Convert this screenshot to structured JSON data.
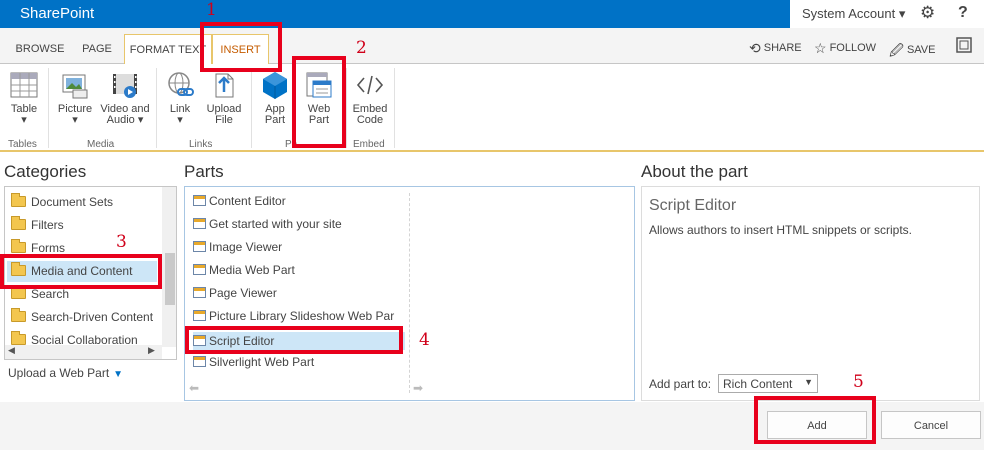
{
  "suite": {
    "brand": "SharePoint",
    "account": "System Account",
    "account_caret": "▾",
    "settings_icon": "gear-icon",
    "help_icon": "?"
  },
  "tabs": [
    "BROWSE",
    "PAGE",
    "FORMAT TEXT",
    "INSERT"
  ],
  "selected_tab": "INSERT",
  "ribbon_tools": {
    "share": "SHARE",
    "follow": "FOLLOW",
    "save": "SAVE"
  },
  "ribbon": {
    "buttons": {
      "table": "Table",
      "picture": "Picture",
      "video_audio_1": "Video and",
      "video_audio_2": "Audio",
      "link": "Link",
      "upload_1": "Upload",
      "upload_2": "File",
      "app_part_1": "App",
      "app_part_2": "Part",
      "web_part_1": "Web",
      "web_part_2": "Part",
      "embed_1": "Embed",
      "embed_2": "Code",
      "caret": "▾"
    },
    "groups": {
      "tables": "Tables",
      "media": "Media",
      "links": "Links",
      "parts": "Pa",
      "embed": "Embed"
    }
  },
  "categories": {
    "title": "Categories",
    "items": [
      "Document Sets",
      "Filters",
      "Forms",
      "Media and Content",
      "Search",
      "Search-Driven Content",
      "Social Collaboration"
    ],
    "selected": "Media and Content",
    "upload": "Upload a Web Part",
    "upload_caret": "▼"
  },
  "parts": {
    "title": "Parts",
    "items": [
      "Content Editor",
      "Get started with your site",
      "Image Viewer",
      "Media Web Part",
      "Page Viewer",
      "Picture Library Slideshow Web Par",
      "Script Editor",
      "Silverlight Web Part"
    ],
    "selected": "Script Editor"
  },
  "about": {
    "title": "About the part",
    "name": "Script Editor",
    "description": "Allows authors to insert HTML snippets or scripts.",
    "add_to_label": "Add part to:",
    "add_to_value": "Rich Content",
    "dropdown_caret": "▼"
  },
  "footer": {
    "add": "Add",
    "cancel": "Cancel"
  },
  "annotations": [
    "1",
    "2",
    "3",
    "4",
    "5"
  ],
  "colors": {
    "suite_blue": "#0072c6",
    "annotation_red": "#e8001c",
    "selected_tab": "#c55c00",
    "selection_bg": "#cde6f7"
  }
}
